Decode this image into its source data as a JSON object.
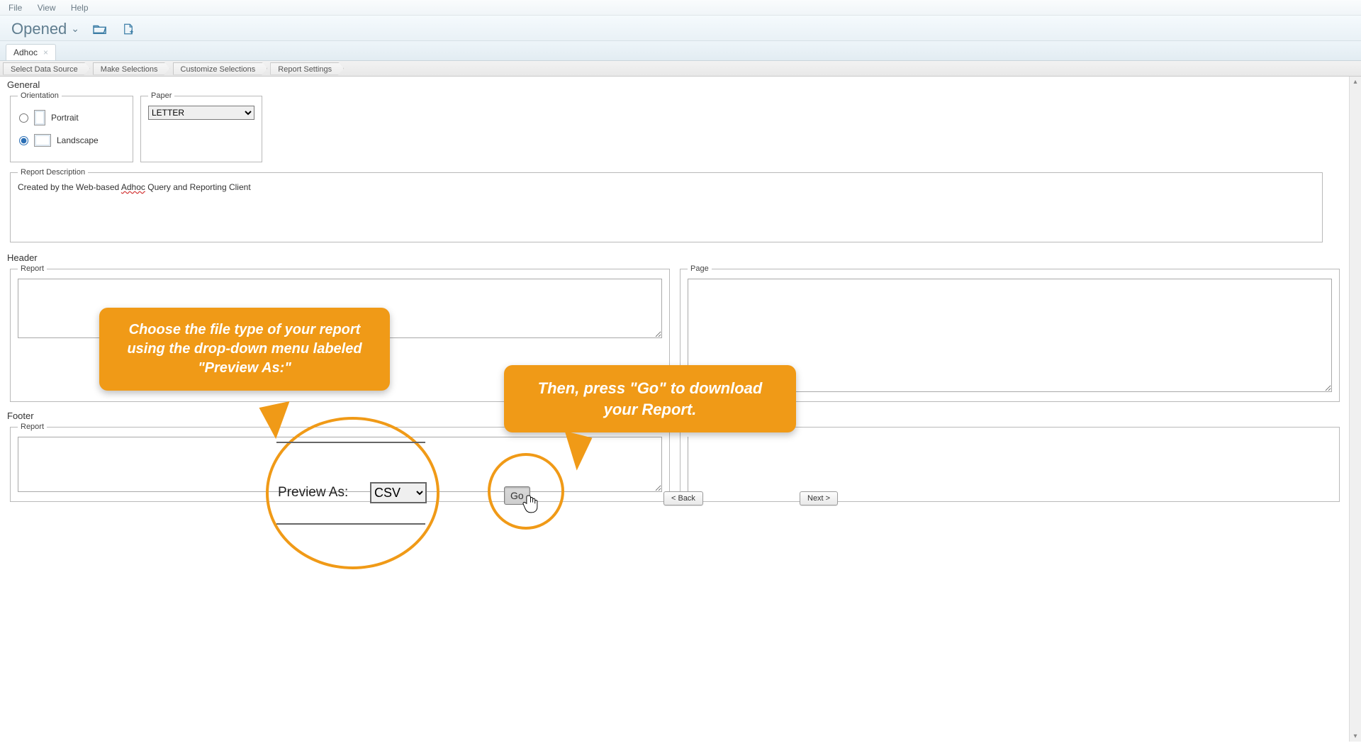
{
  "menubar": {
    "file": "File",
    "view": "View",
    "help": "Help"
  },
  "toolbar": {
    "opened": "Opened"
  },
  "tab": {
    "label": "Adhoc"
  },
  "breadcrumb": {
    "step1": "Select Data Source",
    "step2": "Make Selections",
    "step3": "Customize Selections",
    "step4": "Report Settings"
  },
  "sections": {
    "general": "General",
    "header": "Header",
    "footer": "Footer"
  },
  "fieldsets": {
    "orientation": "Orientation",
    "paper": "Paper",
    "report_description": "Report Description",
    "report": "Report",
    "page": "Page"
  },
  "orientation": {
    "portrait": "Portrait",
    "landscape": "Landscape",
    "selected": "landscape"
  },
  "paper": {
    "value": "LETTER"
  },
  "description": {
    "prefix": "Created by the Web-based ",
    "adhoc": "Adhoc",
    "suffix": " Query and Reporting Client"
  },
  "header_report": "",
  "header_page": "",
  "footer_report": "",
  "preview": {
    "label": "Preview As:",
    "value": "CSV",
    "go": "Go"
  },
  "nav": {
    "back": "< Back",
    "next": "Next >"
  },
  "callouts": {
    "c1": "Choose the file type of your report using the drop-down menu labeled \"Preview As:\"",
    "c2": "Then, press \"Go\" to download your Report."
  }
}
